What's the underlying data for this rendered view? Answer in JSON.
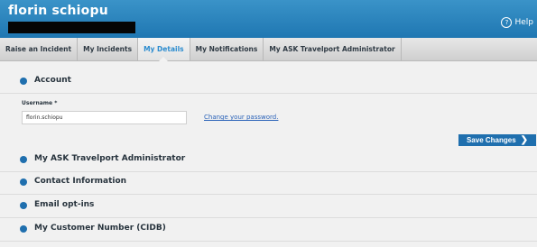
{
  "header": {
    "user_name": "florin schiopu",
    "help_label": "Help",
    "help_icon": "question-circle-icon"
  },
  "tabs": [
    {
      "label": "Raise an Incident",
      "active": false
    },
    {
      "label": "My Incidents",
      "active": false
    },
    {
      "label": "My Details",
      "active": true
    },
    {
      "label": "My Notifications",
      "active": false
    },
    {
      "label": "My ASK Travelport Administrator",
      "active": false
    }
  ],
  "account": {
    "title": "Account",
    "username_label": "Username *",
    "username_value": "florin.schiopu",
    "change_password_link": "Change your password.",
    "save_button": "Save Changes"
  },
  "sections": [
    {
      "title": "My ASK Travelport Administrator"
    },
    {
      "title": "Contact Information"
    },
    {
      "title": "Email opt-ins"
    },
    {
      "title": "My Customer Number (CIDB)"
    }
  ]
}
